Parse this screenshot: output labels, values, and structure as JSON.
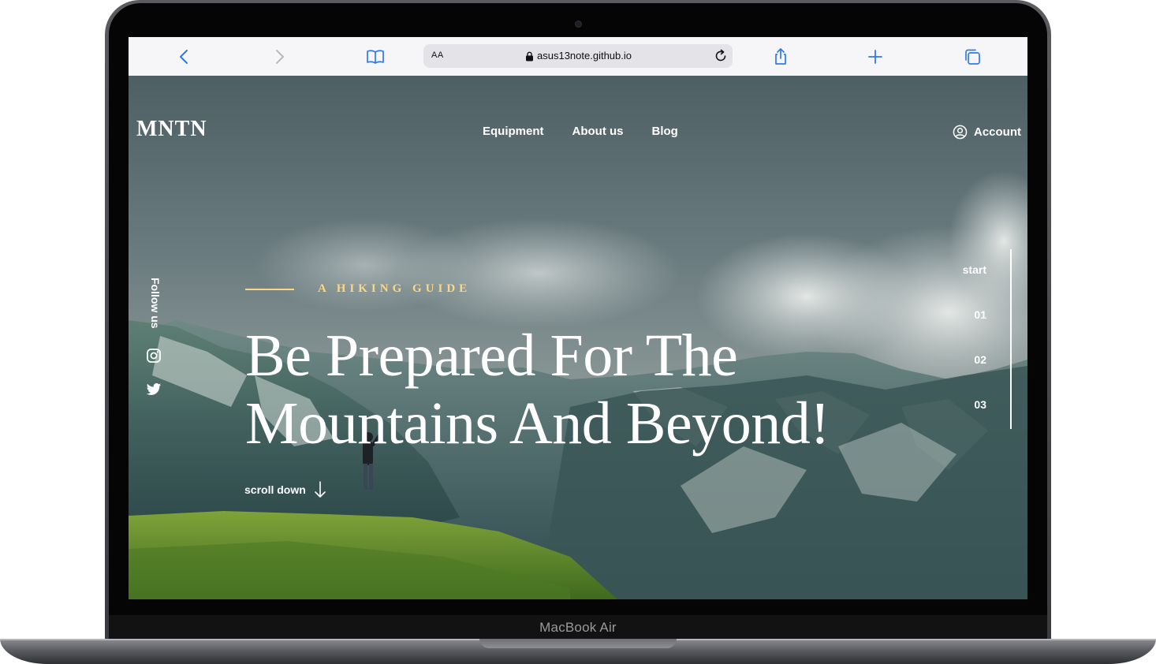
{
  "device": {
    "model_label": "MacBook Air"
  },
  "browser": {
    "reader_label": "AA",
    "url": "asus13note.github.io",
    "icons": [
      "back-icon",
      "forward-icon",
      "bookmarks-icon",
      "lock-icon",
      "reload-icon",
      "share-icon",
      "new-tab-icon",
      "tabs-icon"
    ]
  },
  "site": {
    "logo": "MNTN",
    "nav": [
      {
        "label": "Equipment"
      },
      {
        "label": "About us"
      },
      {
        "label": "Blog"
      }
    ],
    "account_label": "Account",
    "follow_label": "Follow us",
    "eyebrow": "A HIKING GUIDE",
    "headline": "Be Prepared For The Mountains And Beyond!",
    "scroll_label": "scroll down",
    "slides": [
      {
        "label": "start"
      },
      {
        "label": "01"
      },
      {
        "label": "02"
      },
      {
        "label": "03"
      }
    ],
    "colors": {
      "accent": "#fbd784",
      "text": "#ffffff",
      "link_blue": "#2f7bea"
    }
  }
}
